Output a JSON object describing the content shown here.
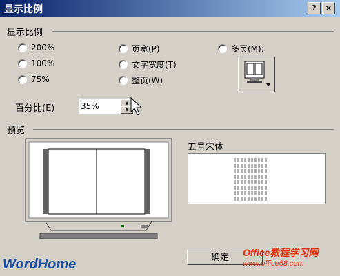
{
  "window": {
    "title": "显示比例",
    "help": "?",
    "close": "×"
  },
  "zoom_group": {
    "label": "显示比例"
  },
  "radios": {
    "r200": "200%",
    "r100": "100%",
    "r75": "75%",
    "page_width": "页宽(P)",
    "text_width": "文字宽度(T)",
    "whole_page": "整页(W)",
    "many_pages": "多页(M):"
  },
  "percent": {
    "label": "百分比(E)",
    "value": "35%"
  },
  "preview_group": {
    "label": "预览"
  },
  "sample": {
    "title": "五号宋体",
    "line_count": 8
  },
  "buttons": {
    "ok": "确定"
  },
  "watermarks": {
    "left": "WordHome",
    "right_top": "Office教程学习网",
    "right_bottom": "www.office68.com"
  }
}
